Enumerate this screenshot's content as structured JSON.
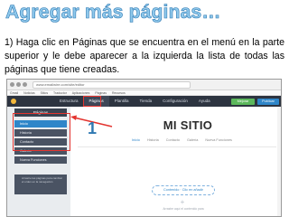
{
  "slide": {
    "title": "Agregar más páginas…",
    "instruction": "1) Haga clic en Páginas que se encuentra en el menú en la parte superior y le debe aparecer a la izquierda la lista de todas las páginas que tiene creadas."
  },
  "browser": {
    "url": "www.emailwire.com/site/editor",
    "bookmarks": [
      "Gmail",
      "Noticias",
      "Sitios",
      "Traductor",
      "Aplicaciones",
      "Páginas",
      "Recursos"
    ]
  },
  "editor": {
    "menu": [
      {
        "label": "Estructura",
        "active": false
      },
      {
        "label": "Páginas",
        "active": true
      },
      {
        "label": "Plantilla",
        "active": false
      },
      {
        "label": "Tienda",
        "active": false
      },
      {
        "label": "Configuración",
        "active": false
      },
      {
        "label": "Ayuda",
        "active": false
      }
    ],
    "buttons": {
      "upgrade": "Mejorar",
      "publish": "Publicar"
    },
    "sidebar": {
      "header": "Páginas",
      "items": [
        "Inicio",
        "Historia",
        "Contacto",
        "Galería",
        "Nueva Funciones"
      ],
      "selected_index": 0,
      "note": "Arrastre las páginas para cambiar el orden en la navegación"
    },
    "step_marker": "1",
    "site": {
      "title": "MI SITIO",
      "nav": [
        "Inicio",
        "Historia",
        "Contacto",
        "Galería",
        "Nueva Funciones"
      ],
      "add_content": "Contenido · Clic en añadir",
      "plus": "+",
      "helper": "Arrastre aquí el contenido para"
    },
    "colors": {
      "topbar": "#2d3440",
      "accent": "#2f86c9",
      "highlight": "#e3342f",
      "upgrade_button": "#5cb85c"
    }
  }
}
